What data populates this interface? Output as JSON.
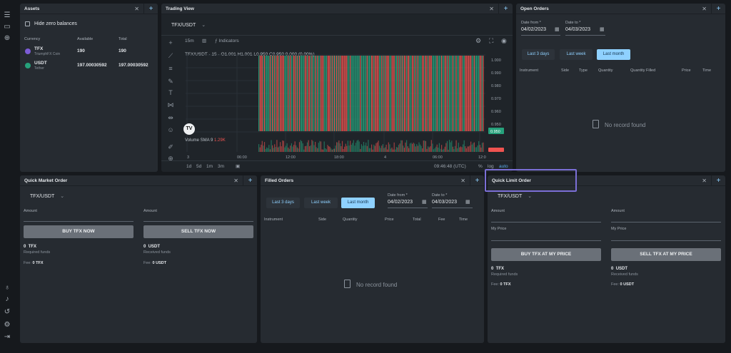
{
  "assets": {
    "title": "Assets",
    "hide_zero": "Hide zero balances",
    "col_currency": "Currency",
    "col_available": "Available",
    "col_total": "Total",
    "rows": [
      {
        "symbol": "TFX",
        "name": "TriumphFX Coin",
        "available": "190",
        "total": "190",
        "color": "#7c5cd6"
      },
      {
        "symbol": "USDT",
        "name": "Tether",
        "available": "197.00030592",
        "total": "197.00030592",
        "color": "#26a17b"
      }
    ]
  },
  "trading": {
    "title": "Trading View",
    "pair": "TFX/USDT",
    "interval": "15m",
    "indicators": "Indicators",
    "legend": "TFX/USDT · 15 · O1.001 H1.001 L0.950 C0.950 0.000 (0.00%)",
    "volume": "Volume SMA 9",
    "volume_val": "1.29K",
    "price_ticks": [
      "1.000",
      "0.990",
      "0.980",
      "0.970",
      "0.960",
      "0.950"
    ],
    "last_price": "0.950",
    "time_ticks": [
      "3",
      "06:00",
      "12:00",
      "18:00",
      "4",
      "06:00",
      "12:0"
    ],
    "ranges": [
      "1d",
      "5d",
      "1m",
      "3m"
    ],
    "clock": "09:46:48 (UTC)",
    "pct": "%",
    "log": "log",
    "auto": "auto"
  },
  "open_orders": {
    "title": "Open Orders",
    "date_from_label": "Date from *",
    "date_from": "04/02/2023",
    "date_to_label": "Date to *",
    "date_to": "04/03/2023",
    "chips": [
      "Last 3 days",
      "Last week",
      "Last month"
    ],
    "cols": [
      "Instrument",
      "Side",
      "Type",
      "Quantity",
      "Quantity Filled",
      "Price",
      "Time"
    ],
    "empty": "No record found"
  },
  "quick_market": {
    "title": "Quick Market Order",
    "pair": "TFX/USDT",
    "amount": "Amount",
    "buy": "BUY TFX NOW",
    "sell": "SELL TFX NOW",
    "buy_val": "0",
    "buy_cur": "TFX",
    "buy_sub": "Required funds",
    "sell_val": "0",
    "sell_cur": "USDT",
    "sell_sub": "Received funds",
    "fee_label": "Fee:",
    "buy_fee": "0",
    "buy_fee_cur": "TFX",
    "sell_fee": "0",
    "sell_fee_cur": "USDT"
  },
  "filled": {
    "title": "Filled Orders",
    "chips": [
      "Last 3 days",
      "Last week",
      "Last month"
    ],
    "date_from_label": "Date from *",
    "date_from": "04/02/2023",
    "date_to_label": "Date to *",
    "date_to": "04/03/2023",
    "cols": [
      "Instrument",
      "Side",
      "Quantity",
      "Price",
      "Total",
      "Fee",
      "Time"
    ],
    "empty": "No record found"
  },
  "quick_limit": {
    "title": "Quick Limit Order",
    "pair": "TFX/USDT",
    "amount": "Amount",
    "my_price": "My Price",
    "buy": "BUY TFX AT MY PRICE",
    "sell": "SELL TFX AT MY PRICE",
    "buy_val": "0",
    "buy_cur": "TFX",
    "buy_sub": "Required funds",
    "sell_val": "0",
    "sell_cur": "USDT",
    "sell_sub": "Received funds",
    "fee_label": "Fee:",
    "buy_fee": "0",
    "buy_fee_cur": "TFX",
    "sell_fee": "0",
    "sell_fee_cur": "USDT"
  },
  "colors": {
    "up": "#26a17b",
    "down": "#ef5350",
    "accent": "#8fd1ff",
    "highlight": "#7b6fd6"
  }
}
